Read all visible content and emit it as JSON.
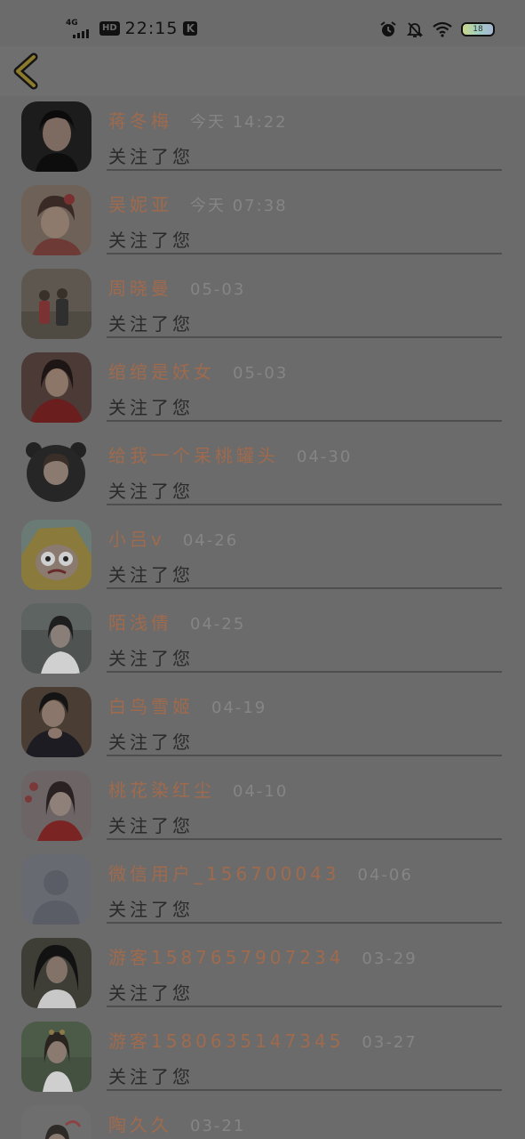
{
  "status_bar": {
    "network_label": "4G",
    "hd_label": "HD",
    "time": "22:15",
    "k_label": "K",
    "battery_level": "18",
    "icons": [
      "alarm-icon",
      "mute-bell-icon",
      "wifi-icon",
      "battery-icon"
    ]
  },
  "header": {
    "back_icon": "chevron-left-icon",
    "accent_color": "#e0c83a"
  },
  "colors": {
    "name": "#a06a4c",
    "time": "#858585",
    "text": "#2a2a2a",
    "divider": "#4e4e4e"
  },
  "followers": [
    {
      "name": "蒋冬梅",
      "time": "今天 14:22",
      "action": "关注了您"
    },
    {
      "name": "吴妮亚",
      "time": "今天 07:38",
      "action": "关注了您"
    },
    {
      "name": "周晓曼",
      "time": "05-03",
      "action": "关注了您"
    },
    {
      "name": "绾绾是妖女",
      "time": "05-03",
      "action": "关注了您"
    },
    {
      "name": "给我一个呆桃罐头",
      "time": "04-30",
      "action": "关注了您"
    },
    {
      "name": "小吕v",
      "time": "04-26",
      "action": "关注了您"
    },
    {
      "name": "陌浅倩",
      "time": "04-25",
      "action": "关注了您"
    },
    {
      "name": "白鸟雪姬",
      "time": "04-19",
      "action": "关注了您"
    },
    {
      "name": "桃花染红尘",
      "time": "04-10",
      "action": "关注了您"
    },
    {
      "name": "微信用户_156700043",
      "time": "04-06",
      "action": "关注了您"
    },
    {
      "name": "游客15876579072​34",
      "time": "03-29",
      "action": "关注了您"
    },
    {
      "name": "游客15806351473​45",
      "time": "03-27",
      "action": "关注了您"
    },
    {
      "name": "陶久久",
      "time": "03-21",
      "action": ""
    }
  ]
}
